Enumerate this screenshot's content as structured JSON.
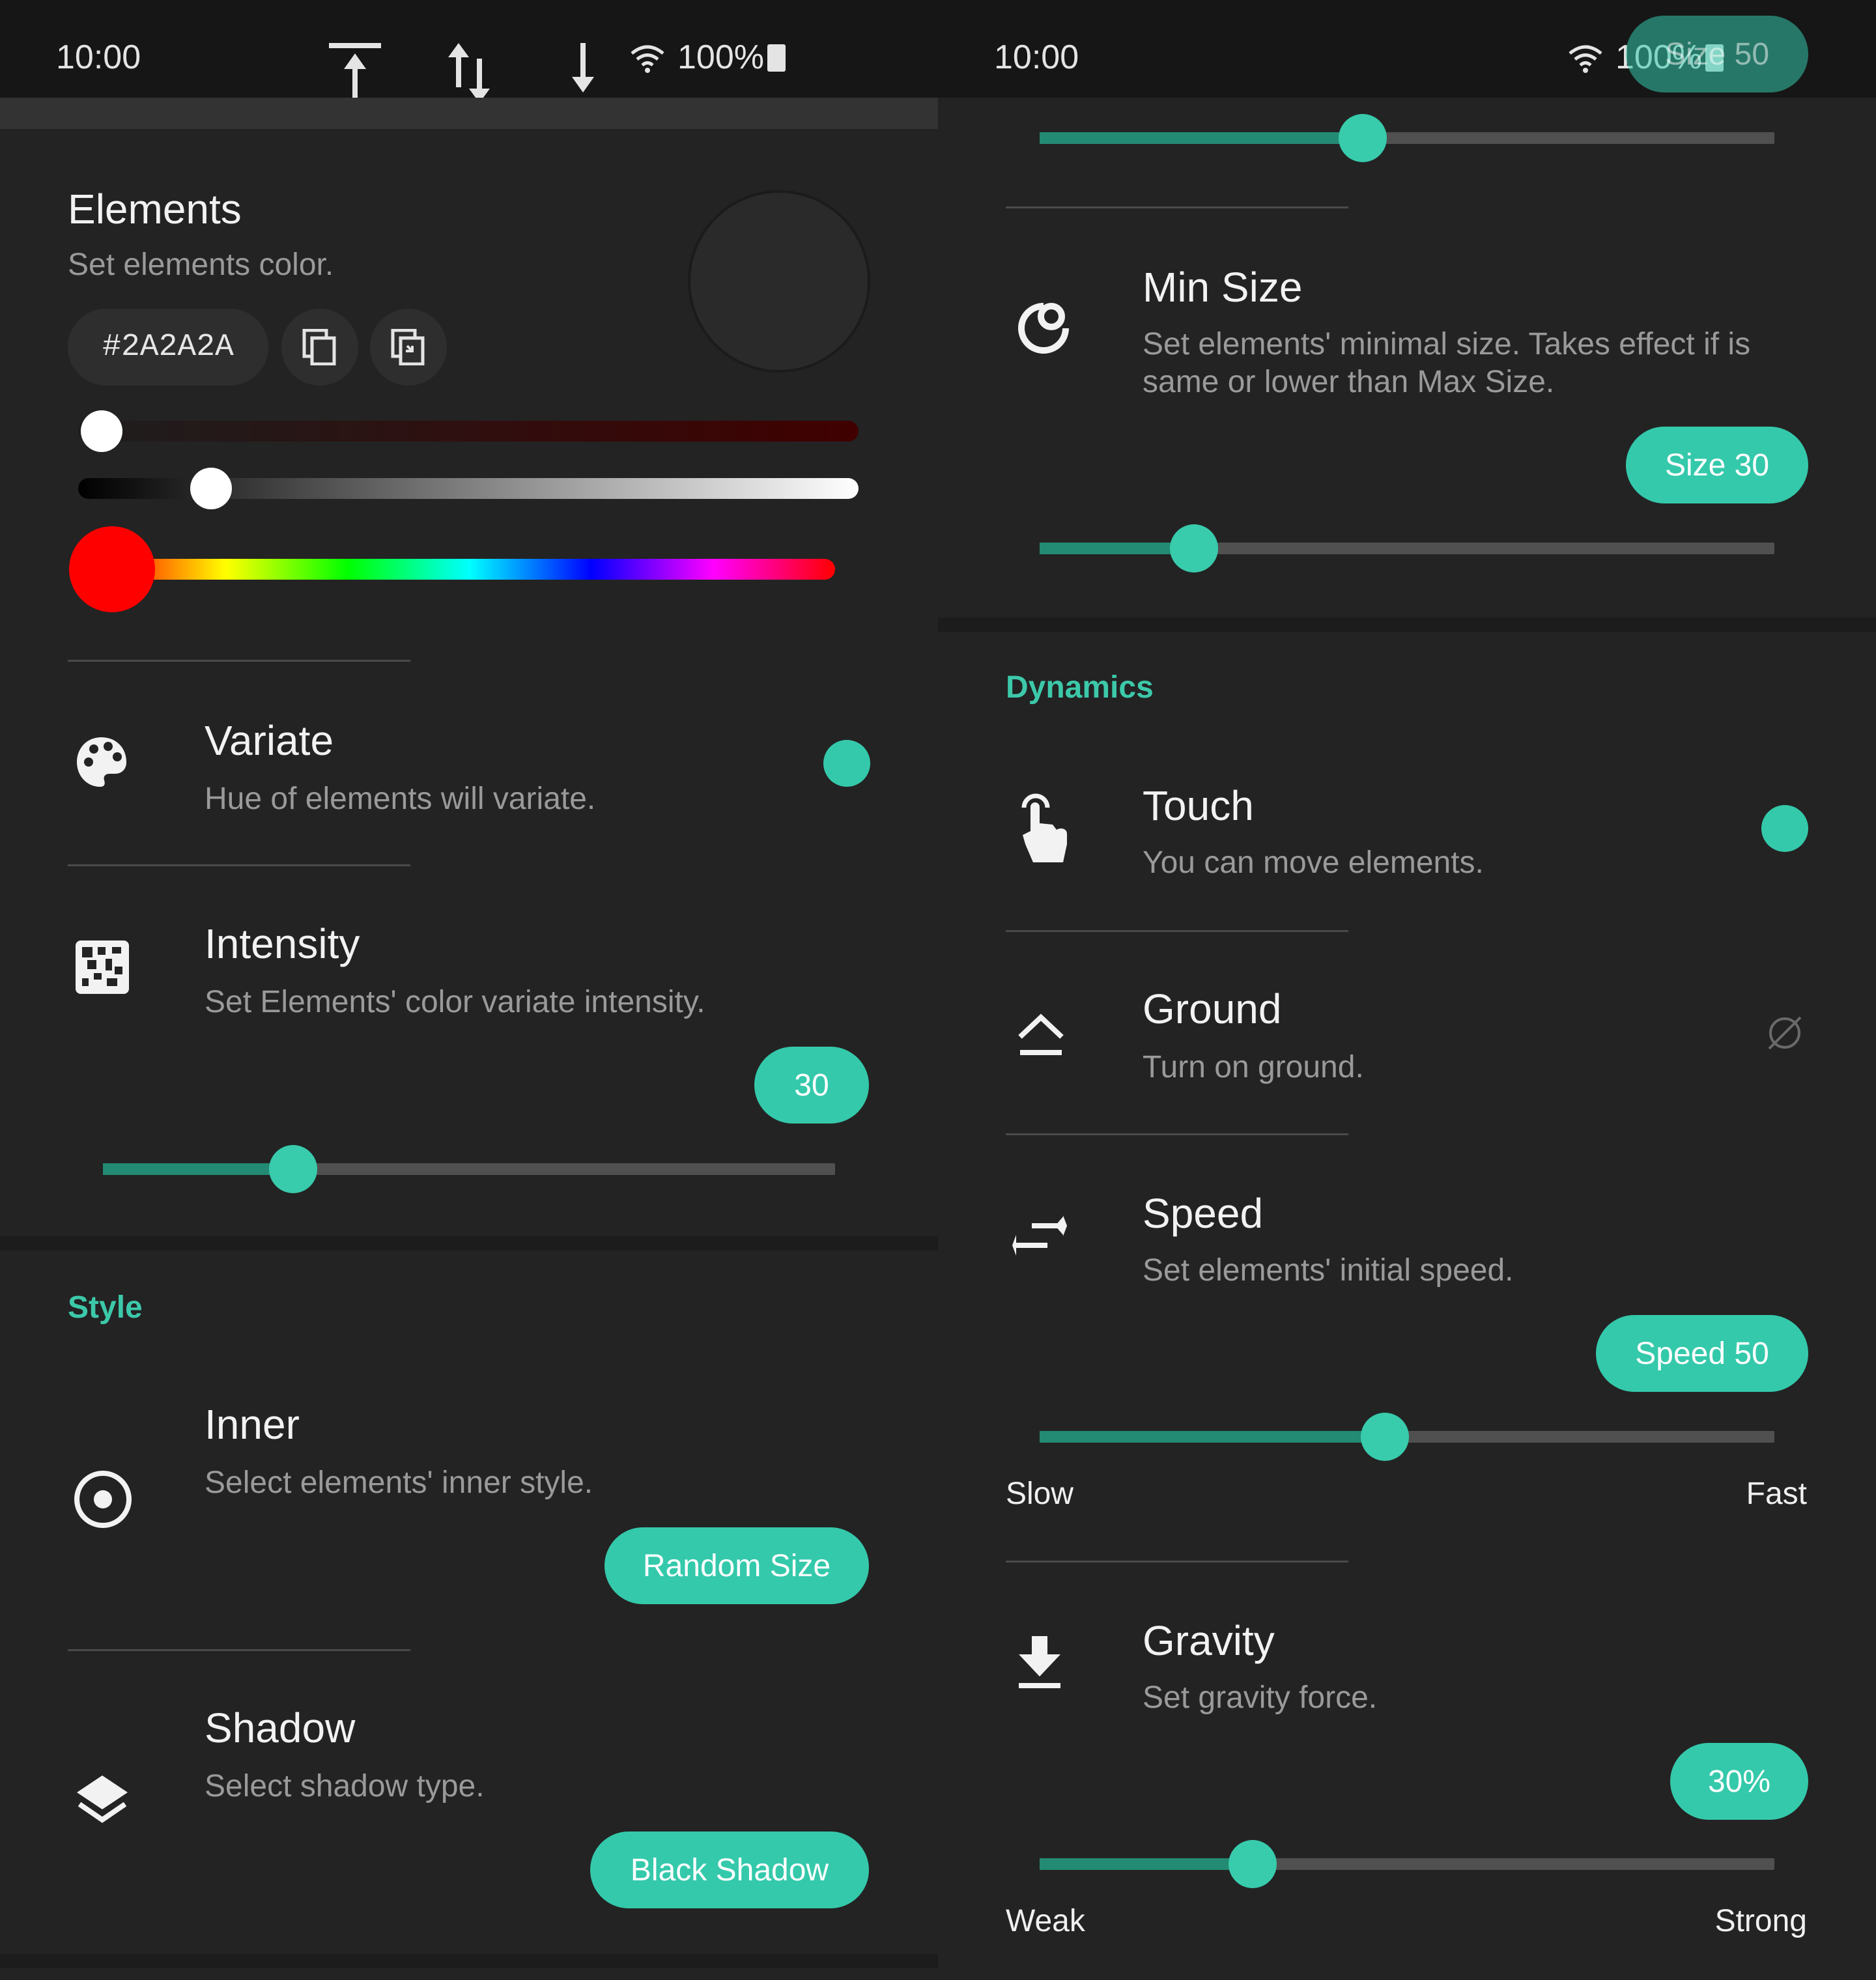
{
  "left": {
    "status": {
      "time": "10:00",
      "battery": "100%"
    },
    "elements": {
      "title": "Elements",
      "desc": "Set elements color.",
      "hex": "#2A2A2A",
      "preview_color": "#2A2A2A",
      "red_value": 0.03,
      "gray_value": 0.17,
      "hue_value": 0.0
    },
    "variate": {
      "title": "Variate",
      "desc": "Hue of elements will variate."
    },
    "intensity": {
      "title": "Intensity",
      "desc": "Set Elements' color variate intensity.",
      "badge": "30",
      "value": 0.26
    },
    "style_header": "Style",
    "inner": {
      "title": "Inner",
      "desc": "Select elements' inner style.",
      "button": "Random Size"
    },
    "shadow": {
      "title": "Shadow",
      "desc": "Select shadow type.",
      "button": "Black Shadow"
    }
  },
  "right": {
    "status": {
      "time": "10:00",
      "battery": "100%"
    },
    "floating_badge": "Size 50",
    "top_slider_value": 0.44,
    "min_size": {
      "title": "Min Size",
      "desc": "Set elements' minimal size. Takes effect if is same or lower than Max Size.",
      "badge": "Size 30",
      "value": 0.21
    },
    "dynamics_header": "Dynamics",
    "touch": {
      "title": "Touch",
      "desc": "You can move elements."
    },
    "ground": {
      "title": "Ground",
      "desc": "Turn on ground."
    },
    "speed": {
      "title": "Speed",
      "desc": "Set elements' initial speed.",
      "badge": "Speed 50",
      "value": 0.47,
      "min_label": "Slow",
      "max_label": "Fast"
    },
    "gravity": {
      "title": "Gravity",
      "desc": "Set gravity force.",
      "badge": "30%",
      "value": 0.29,
      "min_label": "Weak",
      "max_label": "Strong"
    }
  },
  "colors": {
    "accent": "#34C9AB",
    "accent_dark": "#238A73",
    "background": "#232323"
  }
}
